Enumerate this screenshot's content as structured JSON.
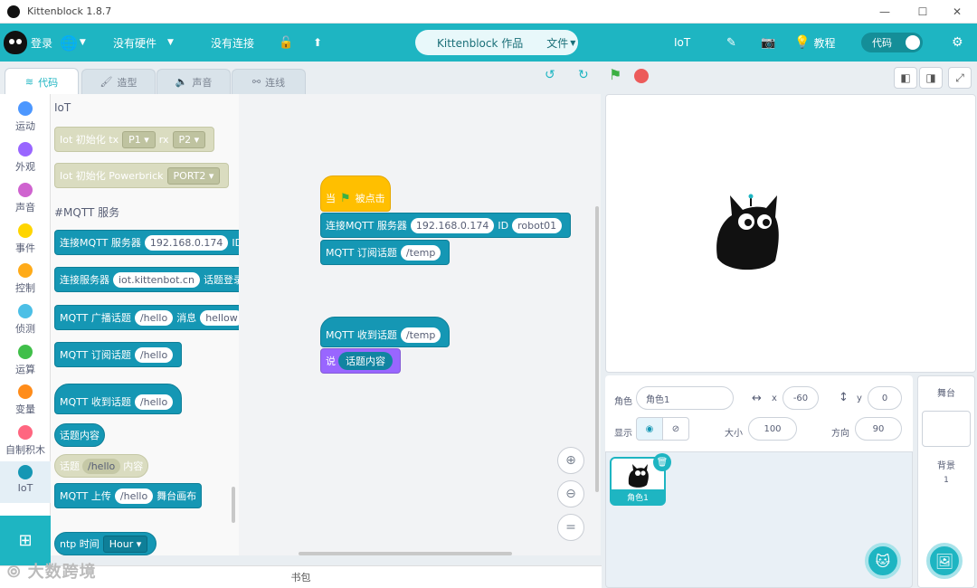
{
  "window": {
    "title": "Kittenblock 1.8.7",
    "min": "—",
    "max": "☐",
    "close": "✕"
  },
  "menubar": {
    "login": "登录",
    "hardware": "没有硬件",
    "connection": "没有连接",
    "project": "Kittenblock 作品",
    "file": "文件",
    "iot": "IoT",
    "tutorial": "教程",
    "code_toggle": "代码"
  },
  "tabs": [
    "代码",
    "造型",
    "声音",
    "连线"
  ],
  "categories": [
    {
      "label": "运动",
      "color": "#4c97ff"
    },
    {
      "label": "外观",
      "color": "#9966ff"
    },
    {
      "label": "声音",
      "color": "#cf63cf"
    },
    {
      "label": "事件",
      "color": "#ffd500"
    },
    {
      "label": "控制",
      "color": "#ffab19"
    },
    {
      "label": "侦测",
      "color": "#4cbfe6"
    },
    {
      "label": "运算",
      "color": "#40bf4a"
    },
    {
      "label": "变量",
      "color": "#ff8c1a"
    },
    {
      "label": "自制积木",
      "color": "#ff6680"
    },
    {
      "label": "IoT",
      "color": "#1597b4"
    }
  ],
  "palette": {
    "title_iot": "IoT",
    "iot_init_tx": {
      "t1": "Iot 初始化 tx",
      "v1": "P1",
      "t2": "rx",
      "v2": "P2"
    },
    "iot_init_pb": {
      "t1": "Iot 初始化 Powerbrick",
      "v1": "PORT2"
    },
    "title_mqtt": "#MQTT 服务",
    "connect_mqtt": {
      "t1": "连接MQTT 服务器",
      "v1": "192.168.0.174",
      "t2": "ID"
    },
    "connect_server": {
      "t1": "连接服务器",
      "v1": "iot.kittenbot.cn",
      "t2": "话题登录名"
    },
    "broadcast": {
      "t1": "MQTT 广播话题",
      "v1": "/hello",
      "t2": "消息",
      "v2": "hellow"
    },
    "subscribe": {
      "t1": "MQTT 订阅话题",
      "v1": "/hello"
    },
    "receive": {
      "t1": "MQTT 收到话题",
      "v1": "/hello"
    },
    "topic_content": "话题内容",
    "topic_x": {
      "t1": "话题",
      "v1": "/hello",
      "t2": "内容"
    },
    "upload": {
      "t1": "MQTT 上传",
      "v1": "/hello",
      "t2": "舞台画布"
    },
    "ntp": {
      "t1": "ntp 时间",
      "v1": "Hour"
    }
  },
  "workspace": {
    "when_flag": {
      "t1": "当",
      "t2": "被点击"
    },
    "connect": {
      "t1": "连接MQTT 服务器",
      "v1": "192.168.0.174",
      "t2": "ID",
      "v2": "robot01"
    },
    "subscribe": {
      "t1": "MQTT 订阅话题",
      "v1": "/temp"
    },
    "receive": {
      "t1": "MQTT 收到话题",
      "v1": "/temp"
    },
    "say": {
      "t1": "说",
      "v1": "话题内容"
    }
  },
  "backpack": "书包",
  "sprite_info": {
    "sprite_label": "角色",
    "sprite_name": "角色1",
    "x_label": "x",
    "x": "-60",
    "y_label": "y",
    "y": "0",
    "show_label": "显示",
    "size_label": "大小",
    "size": "100",
    "dir_label": "方向",
    "direction": "90"
  },
  "sprite_tile": "角色1",
  "stage_panel": {
    "title": "舞台",
    "backdrop_label": "背景",
    "backdrop_count": "1"
  },
  "watermark": "大数跨境"
}
